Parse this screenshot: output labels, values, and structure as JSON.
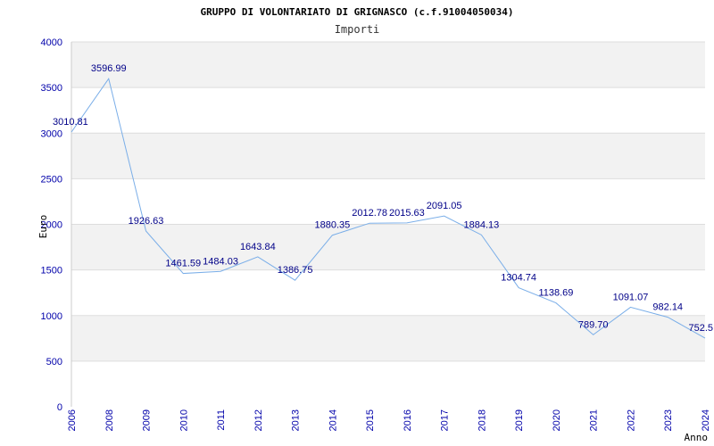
{
  "chart_data": {
    "type": "line",
    "title": "GRUPPO DI VOLONTARIATO DI GRIGNASCO (c.f.91004050034)",
    "subtitle": "Importi",
    "xlabel": "Anno",
    "ylabel": "Euro",
    "ylim": [
      0,
      4000
    ],
    "yticks": [
      0,
      500,
      1000,
      1500,
      2000,
      2500,
      3000,
      3500,
      4000
    ],
    "grid": true,
    "x": [
      "2006",
      "2008",
      "2009",
      "2010",
      "2011",
      "2012",
      "2013",
      "2014",
      "2015",
      "2016",
      "2017",
      "2018",
      "2019",
      "2020",
      "2021",
      "2022",
      "2023",
      "2024"
    ],
    "series": [
      {
        "values": [
          3010.81,
          3596.99,
          1926.63,
          1461.59,
          1484.03,
          1643.84,
          1386.75,
          1880.35,
          2012.78,
          2015.63,
          2091.05,
          1884.13,
          1304.74,
          1138.69,
          789.7,
          1091.07,
          982.14,
          752.5
        ],
        "labels": [
          "3010.81",
          "3596.99",
          "1926.63",
          "1461.59",
          "1484.03",
          "1643.84",
          "1386.75",
          "1880.35",
          "2012.78",
          "2015.63",
          "2091.05",
          "1884.13",
          "1304.74",
          "1138.69",
          "789.70",
          "1091.07",
          "982.14",
          "752.5"
        ]
      }
    ],
    "colors": {
      "line": "#7aaee8",
      "band": "#f2f2f2",
      "grid": "#dddddd",
      "tick_text": "#0000aa",
      "data_label": "#000088"
    }
  }
}
